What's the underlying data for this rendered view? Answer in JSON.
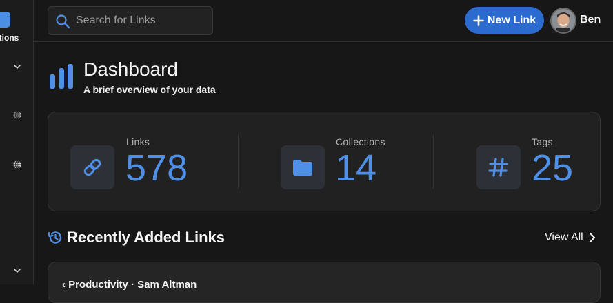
{
  "sidebar": {
    "collections_label": "ctions"
  },
  "search": {
    "placeholder": "Search for Links"
  },
  "header": {
    "new_link_label": "New Link",
    "user_name": "Ben"
  },
  "dashboard": {
    "title": "Dashboard",
    "subtitle": "A brief overview of your data"
  },
  "stats": [
    {
      "label": "Links",
      "value": "578",
      "icon": "link-icon"
    },
    {
      "label": "Collections",
      "value": "14",
      "icon": "folder-icon"
    },
    {
      "label": "Tags",
      "value": "25",
      "icon": "hashtag-icon"
    }
  ],
  "recent": {
    "title": "Recently Added Links",
    "view_all": "View All",
    "first_card_text": "‹ Productivity · Sam Altman"
  },
  "colors": {
    "accent": "#4f90e6",
    "button": "#2b6bd0",
    "background": "#171717",
    "card": "#212121"
  }
}
